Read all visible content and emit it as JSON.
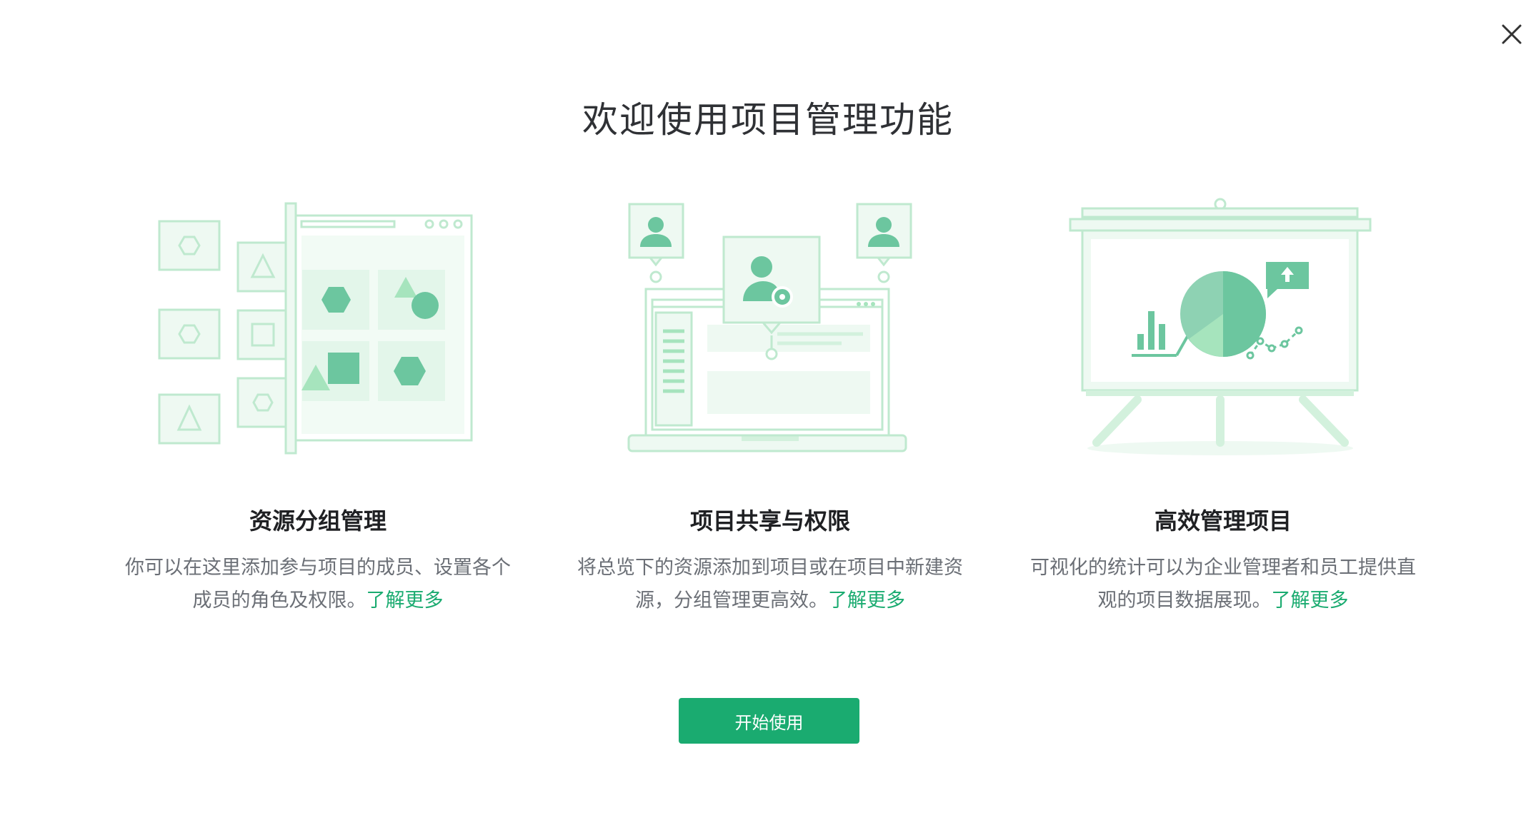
{
  "dialog": {
    "title": "欢迎使用项目管理功能",
    "close_icon": "close-icon"
  },
  "features": [
    {
      "title": "资源分组管理",
      "description": "你可以在这里添加参与项目的成员、设置各个成员的角色及权限。",
      "link": "了解更多",
      "illustration": "resource-group-illustration"
    },
    {
      "title": "项目共享与权限",
      "description": "将总览下的资源添加到项目或在项目中新建资源，分组管理更高效。",
      "link": "了解更多",
      "illustration": "project-share-illustration"
    },
    {
      "title": "高效管理项目",
      "description": "可视化的统计可以为企业管理者和员工提供直观的项目数据展现。",
      "link": "了解更多",
      "illustration": "efficient-management-illustration"
    }
  ],
  "start_button": "开始使用",
  "colors": {
    "accent": "#1aab70",
    "illustration_dark": "#6cc69f",
    "illustration_mid": "#a6e4bd",
    "illustration_light": "#d3f1dd",
    "illustration_bg": "#eef9f2",
    "title_text": "#2f3135",
    "body_text": "#6b6f76"
  }
}
